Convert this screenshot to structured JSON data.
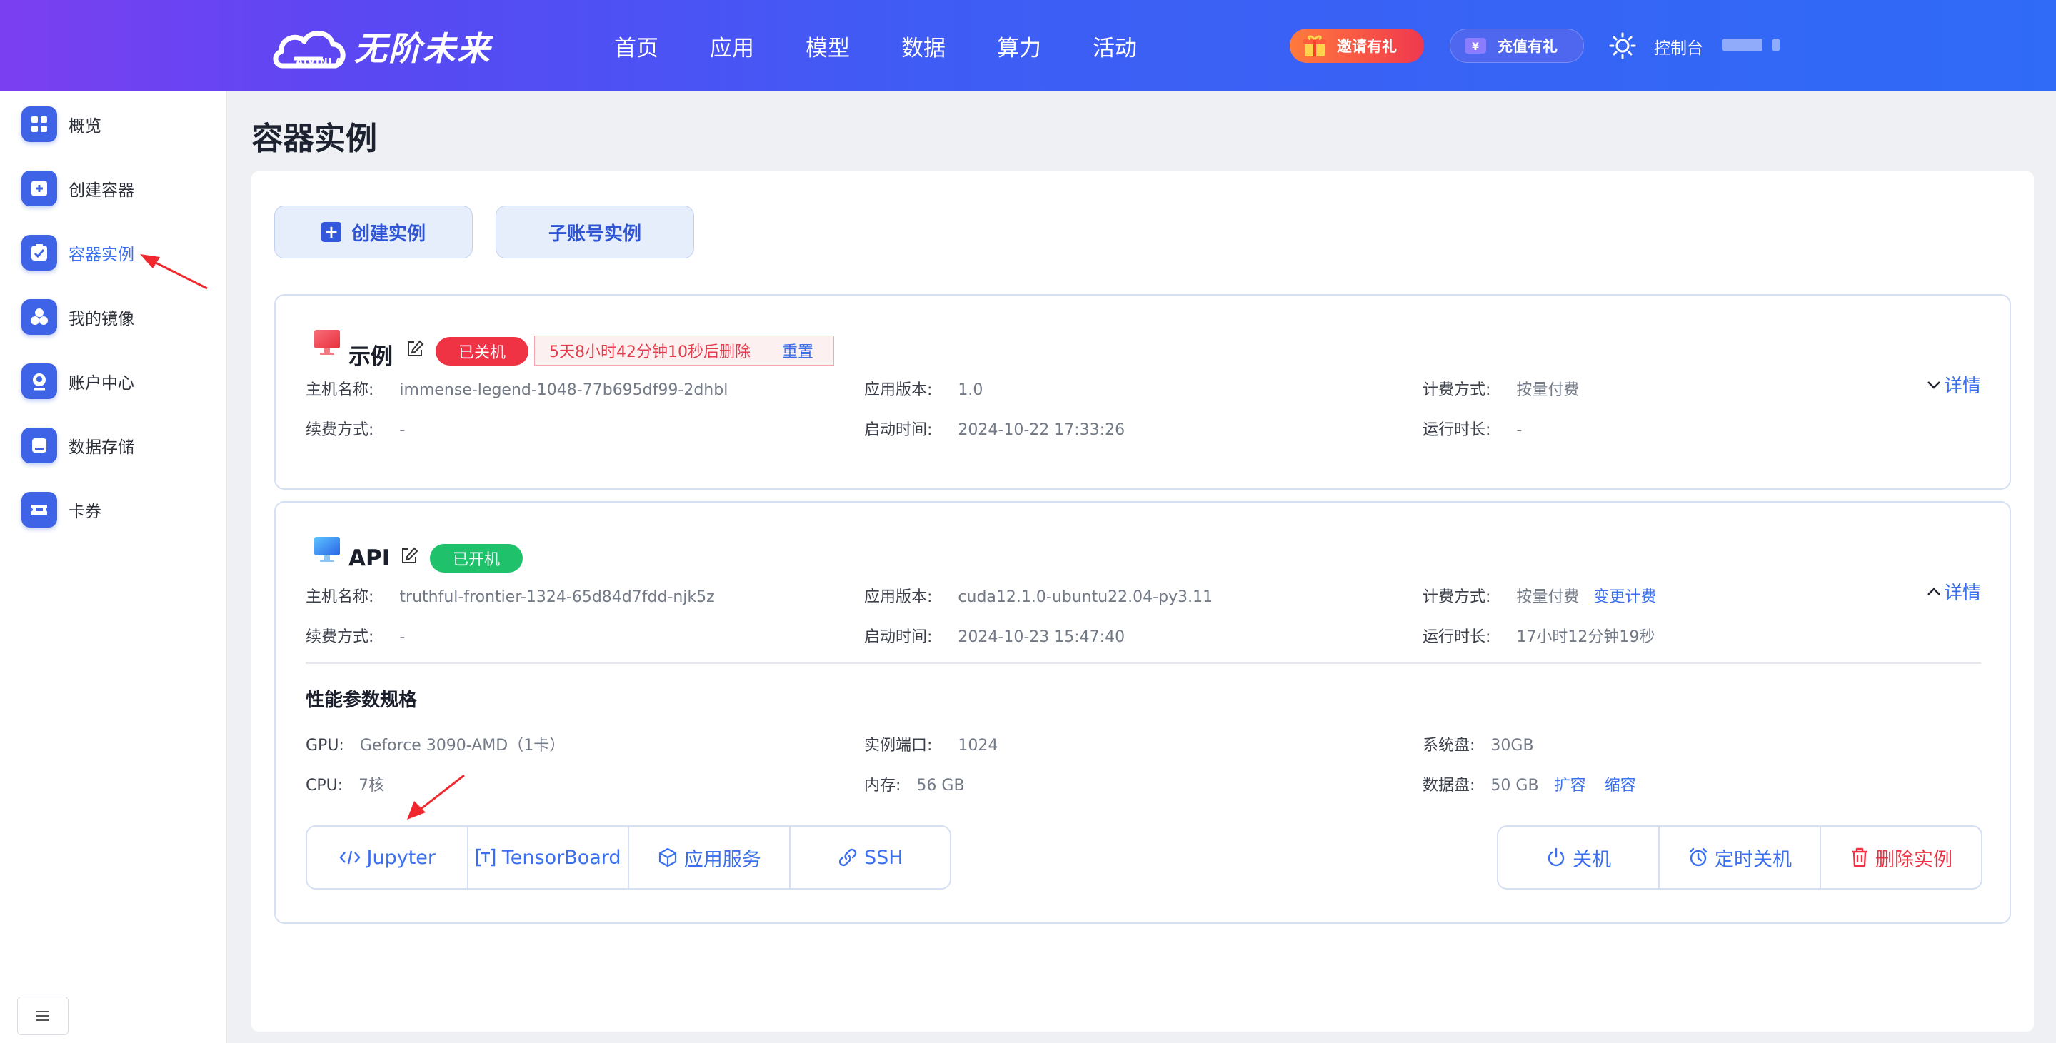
{
  "brand": {
    "name": "无阶未来",
    "sub": "AIVINLA"
  },
  "nav": [
    "首页",
    "应用",
    "模型",
    "数据",
    "算力",
    "活动"
  ],
  "header": {
    "invite_label": "邀请有礼",
    "recharge_label": "充值有礼",
    "console_label": "控制台"
  },
  "sidebar": {
    "items": [
      {
        "label": "概览",
        "icon": "grid-icon"
      },
      {
        "label": "创建容器",
        "icon": "plus-square-icon"
      },
      {
        "label": "容器实例",
        "icon": "check-square-icon",
        "active": true
      },
      {
        "label": "我的镜像",
        "icon": "cubes-icon"
      },
      {
        "label": "账户中心",
        "icon": "user-icon"
      },
      {
        "label": "数据存储",
        "icon": "storage-icon"
      },
      {
        "label": "卡券",
        "icon": "ticket-icon"
      }
    ]
  },
  "page": {
    "title": "容器实例",
    "create_button": "创建实例",
    "sub_account_button": "子账号实例"
  },
  "instances": [
    {
      "name": "示例",
      "status": "已关机",
      "countdown": "5天8小时42分钟10秒后删除",
      "reset_label": "重置",
      "host_label": "主机名称:",
      "host": "immense-legend-1048-77b695df99-2dhbl",
      "version_label": "应用版本:",
      "version": "1.0",
      "billing_label": "计费方式:",
      "billing": "按量付费",
      "renew_label": "续费方式:",
      "renew": "-",
      "start_label": "启动时间:",
      "start": "2024-10-22 17:33:26",
      "runtime_label": "运行时长:",
      "runtime": "-",
      "detail_label": "详情"
    },
    {
      "name": "API",
      "status": "已开机",
      "host_label": "主机名称:",
      "host": "truthful-frontier-1324-65d84d7fdd-njk5z",
      "version_label": "应用版本:",
      "version": "cuda12.1.0-ubuntu22.04-py3.11",
      "billing_label": "计费方式:",
      "billing": "按量付费",
      "change_billing": "变更计费",
      "renew_label": "续费方式:",
      "renew": "-",
      "start_label": "启动时间:",
      "start": "2024-10-23 15:47:40",
      "runtime_label": "运行时长:",
      "runtime": "17小时12分钟19秒",
      "detail_label": "详情",
      "spec_title": "性能参数规格",
      "gpu_label": "GPU:",
      "gpu": "Geforce 3090-AMD（1卡）",
      "port_label": "实例端口:",
      "port": "1024",
      "sysdisk_label": "系统盘:",
      "sysdisk": "30GB",
      "cpu_label": "CPU:",
      "cpu": "7核",
      "mem_label": "内存:",
      "mem": "56 GB",
      "datadisk_label": "数据盘:",
      "datadisk": "50 GB",
      "expand_label": "扩容",
      "shrink_label": "缩容",
      "actions": {
        "jupyter": "Jupyter",
        "tensorboard": "TensorBoard",
        "app_service": "应用服务",
        "ssh": "SSH"
      },
      "power": {
        "shutdown": "关机",
        "timer": "定时关机",
        "delete": "删除实例"
      }
    }
  ],
  "colors": {
    "accent": "#3a6ff0",
    "danger": "#ef3345",
    "success": "#1fc16b",
    "header_start": "#7b3ff0",
    "header_end": "#2f6bf6"
  }
}
